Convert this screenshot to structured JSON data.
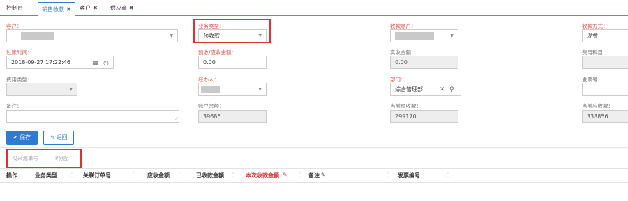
{
  "tabs": [
    {
      "label": "控制台",
      "closable": false
    },
    {
      "label": "销售收款",
      "closable": true,
      "active": true
    },
    {
      "label": "客户",
      "closable": true
    },
    {
      "label": "供应商",
      "closable": true
    }
  ],
  "tab_close": "✖",
  "form": {
    "customer_label": "客户：",
    "biz_type_label": "业务类型：",
    "biz_type_value": "预收款",
    "account_label": "收款账户：",
    "pay_method_label": "收款方式：",
    "pay_method_value": "现金",
    "time_label": "过账时间：",
    "time_value": "2018-09-27 17:22:46",
    "prepaid_label": "预收/应收金额：",
    "prepaid_value": "0.00",
    "actual_label": "实收金额：",
    "actual_value": "0.00",
    "cost_subject_label": "费用科目：",
    "cost_type_label": "费用类型：",
    "handler_label": "经办人：",
    "dept_label": "部门：",
    "dept_value": "综合管理部",
    "invoice_label": "发票号：",
    "remark_label": "备注：",
    "balance_label": "账户余额：",
    "balance_value": "39686",
    "cur_prepaid_label": "当前预收款：",
    "cur_prepaid_value": "299170",
    "cur_receivable_label": "当前应收款：",
    "cur_receivable_value": "338856"
  },
  "buttons": {
    "save": "✔ 保存",
    "back": "↰ 返回"
  },
  "toolbar": {
    "source_no": "Q来源单号",
    "allocate": "P分配"
  },
  "table": {
    "columns": [
      "操作",
      "业务类型",
      "关联订单号",
      "应收金额",
      "已收款金额",
      "本次收款金额",
      "备注",
      "发票编号"
    ],
    "col_sep": "⋮",
    "edit_mark": "✎"
  },
  "colors": {
    "accent": "#2e7bcf",
    "required": "#e5534b",
    "highlight": "#e03030"
  }
}
